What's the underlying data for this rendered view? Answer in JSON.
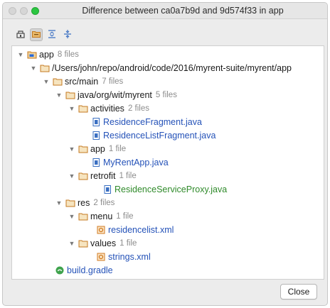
{
  "window": {
    "title": "Difference between ca0a7b9d and 9d574f33 in app"
  },
  "colors": {
    "modified_text": "#2452b8",
    "added_text": "#2f8a2a",
    "folder_orange": "#c47a21",
    "count_gray": "#8c8c8c"
  },
  "toolbar": {
    "buttons": [
      {
        "icon": "module-icon",
        "active": false
      },
      {
        "icon": "group-by-directory-icon",
        "active": true
      },
      {
        "icon": "expand-all-icon",
        "active": false
      },
      {
        "icon": "collapse-all-icon",
        "active": false
      }
    ]
  },
  "tree": {
    "nodes": [
      {
        "label": "app",
        "count": "8 files",
        "kind": "module",
        "status": "normal"
      },
      {
        "label": "/Users/john/repo/android/code/2016/myrent-suite/myrent/app",
        "count": "",
        "kind": "folder",
        "status": "normal"
      },
      {
        "label": "src/main",
        "count": "7 files",
        "kind": "folder",
        "status": "normal"
      },
      {
        "label": "java/org/wit/myrent",
        "count": "5 files",
        "kind": "folder",
        "status": "normal"
      },
      {
        "label": "activities",
        "count": "2 files",
        "kind": "folder",
        "status": "normal"
      },
      {
        "label": "ResidenceFragment.java",
        "count": "",
        "kind": "java",
        "status": "modified"
      },
      {
        "label": "ResidenceListFragment.java",
        "count": "",
        "kind": "java",
        "status": "modified"
      },
      {
        "label": "app",
        "count": "1 file",
        "kind": "folder",
        "status": "normal"
      },
      {
        "label": "MyRentApp.java",
        "count": "",
        "kind": "java",
        "status": "modified"
      },
      {
        "label": "retrofit",
        "count": "1 file",
        "kind": "folder",
        "status": "normal"
      },
      {
        "label": "ResidenceServiceProxy.java",
        "count": "",
        "kind": "java",
        "status": "added"
      },
      {
        "label": "res",
        "count": "2 files",
        "kind": "folder",
        "status": "normal"
      },
      {
        "label": "menu",
        "count": "1 file",
        "kind": "folder",
        "status": "normal"
      },
      {
        "label": "residencelist.xml",
        "count": "",
        "kind": "xml",
        "status": "modified"
      },
      {
        "label": "values",
        "count": "1 file",
        "kind": "folder",
        "status": "normal"
      },
      {
        "label": "strings.xml",
        "count": "",
        "kind": "xml",
        "status": "modified"
      },
      {
        "label": "build.gradle",
        "count": "",
        "kind": "gradle",
        "status": "modified"
      }
    ]
  },
  "footer": {
    "close_label": "Close"
  }
}
